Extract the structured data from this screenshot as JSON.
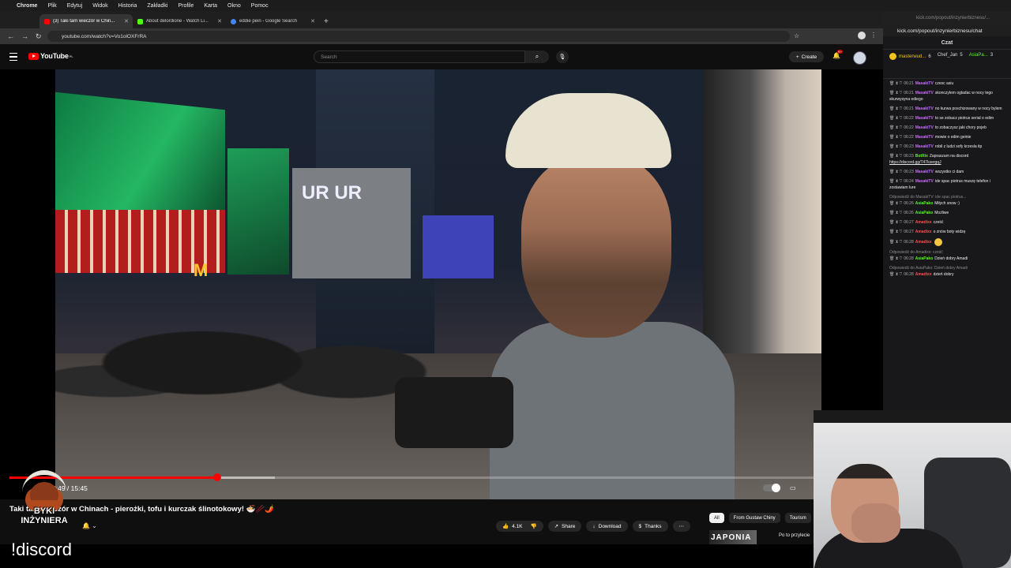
{
  "mac_menu": {
    "apple": "",
    "app": "Chrome",
    "items": [
      "Plik",
      "Edytuj",
      "Widok",
      "Historia",
      "Zakładki",
      "Profile",
      "Karta",
      "Okno",
      "Pomoc"
    ]
  },
  "tabs": [
    {
      "title": "(3) Taki tam wieczór w Chin...",
      "favicon_color": "#ff0000",
      "active": true
    },
    {
      "title": "About delordione - Watch Li...",
      "favicon_color": "#53fc18",
      "active": false
    },
    {
      "title": "eddie pein - Google Search",
      "favicon_color": "#4285f4",
      "active": false
    }
  ],
  "address_bar": {
    "url": "youtube.com/watch?v=Vo1olOXFrRA"
  },
  "youtube": {
    "logo_text": "YouTube",
    "region": "PL",
    "search_placeholder": "Search",
    "create_label": "Create",
    "notification_count": "9+",
    "progress_played_fraction": 0.258,
    "progress_buffer_fraction": 0.33,
    "time_text": "3:49 / 15:45",
    "title": "Taki tam wieczór w Chinach - pierożki, tofu i kurczak ślinotokowy! 🍜🥢🌶️",
    "like_count": "4.1K",
    "share_label": "Share",
    "download_label": "Download",
    "thanks_label": "Thanks",
    "more_label": "⋯",
    "chips": [
      "All",
      "From Gustaw Chiny",
      "Tourism"
    ],
    "related_thumb_text": "JAPONIA",
    "related_title": "Po to przylecie"
  },
  "overlay": {
    "command": "!discord",
    "logo_text": "BYKI INŻYNIERA"
  },
  "kick_chat": {
    "popout_url_short": "kick.com/popout/inzynierbiznesu/...",
    "url": "kick.com/popout/inzynierbiznesu/chat",
    "header": "Czat",
    "pinned": [
      {
        "user": "masterwud...",
        "count": "6"
      },
      {
        "user": "Chef_Jan",
        "count": "5"
      },
      {
        "user": "AsiaPa...",
        "count": "3"
      }
    ],
    "messages": [
      {
        "time": "06:21",
        "user": "MasakiTV",
        "user_color": "#c86bff",
        "text": "czesc asiu"
      },
      {
        "time": "06:21",
        "user": "MasakiTV",
        "user_color": "#c86bff",
        "text": "skonczylem ogladac w nocy tego skurwysyna ediego"
      },
      {
        "time": "06:21",
        "user": "MasakiTV",
        "user_color": "#c86bff",
        "text": "no kurwa poschizowany w nocy bylem"
      },
      {
        "time": "06:22",
        "user": "MasakiTV",
        "user_color": "#c86bff",
        "text": "to se zobacz piotrus serial o edim"
      },
      {
        "time": "06:22",
        "user": "MasakiTV",
        "user_color": "#c86bff",
        "text": "to zobaczysz jaki chory pojeb"
      },
      {
        "time": "06:22",
        "user": "MasakiTV",
        "user_color": "#c86bff",
        "text": "mowie o edim geinie"
      },
      {
        "time": "06:23",
        "user": "MasakiTV",
        "user_color": "#c86bff",
        "text": "robil z ludzi sofy krzesla itp"
      },
      {
        "time": "06:23",
        "user": "BotRix",
        "user_color": "#53fc18",
        "text": "Zapraszam na discord",
        "link": "https://discord.gg/T47ksergqJ"
      },
      {
        "time": "06:23",
        "user": "MasakiTV",
        "user_color": "#c86bff",
        "text": "wszystko ci dam"
      },
      {
        "time": "06:24",
        "user": "MasakiTV",
        "user_color": "#c86bff",
        "text": "ide spac piotrus muszę telefon i zostawiam lure"
      },
      {
        "reply": "Odpowiedź do MasakiTV: ide spac piotrus...",
        "time": "06:26",
        "user": "AsiaPako",
        "user_color": "#53fc18",
        "text": "Miłych snow :)"
      },
      {
        "time": "06:26",
        "user": "AsiaPako",
        "user_color": "#53fc18",
        "text": "Możliwe"
      },
      {
        "time": "06:27",
        "user": "Amadixx",
        "user_color": "#ff4d4d",
        "text": "cześć"
      },
      {
        "time": "06:27",
        "user": "Amadixx",
        "user_color": "#ff4d4d",
        "text": "o znów boty widzę"
      },
      {
        "time": "06:28",
        "user": "Amadixx",
        "user_color": "#ff4d4d",
        "text": "",
        "emoji": true
      },
      {
        "reply": "Odpowiedź do Amadixx: cześć",
        "time": "06:28",
        "user": "AsiaPako",
        "user_color": "#53fc18",
        "text": "Dzień dobry Amadi"
      },
      {
        "reply": "Odpowiedź do AsiaPako: Dzień dobry Amadi",
        "time": "06:28",
        "user": "Amadixx",
        "user_color": "#ff4d4d",
        "text": "dzień dobry"
      }
    ]
  }
}
